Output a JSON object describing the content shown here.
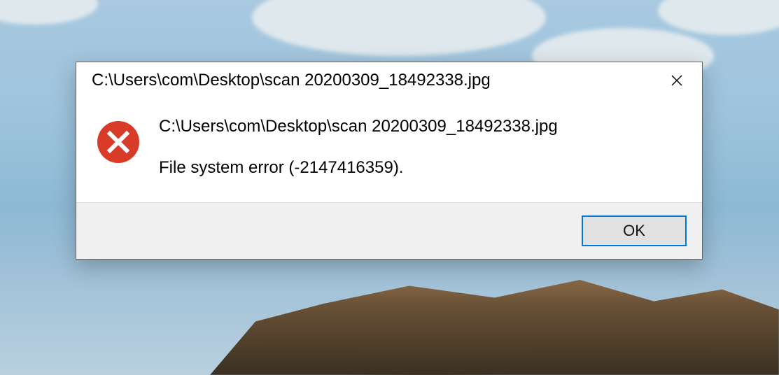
{
  "dialog": {
    "title": "C:\\Users\\com\\Desktop\\scan 20200309_18492338.jpg",
    "message_path": "C:\\Users\\com\\Desktop\\scan 20200309_18492338.jpg",
    "message_error": "File system error (-2147416359).",
    "ok_label": "OK"
  }
}
